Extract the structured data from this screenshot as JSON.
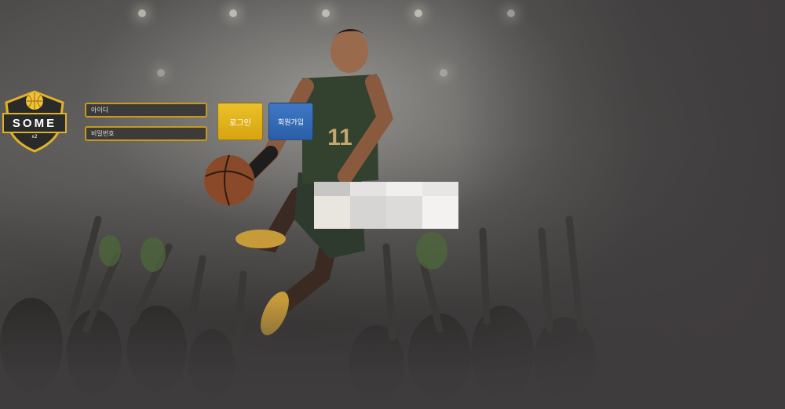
{
  "brand": {
    "name": "SOME",
    "sub": "x2"
  },
  "login": {
    "id_placeholder": "아이디",
    "password_placeholder": "비밀번호",
    "login_label": "로그인",
    "join_label": "회원가입"
  },
  "player": {
    "jersey_number": "11"
  },
  "colors": {
    "accent_gold": "#d6a40f",
    "accent_blue": "#2b5ea7",
    "background": "#3f3c3d"
  }
}
